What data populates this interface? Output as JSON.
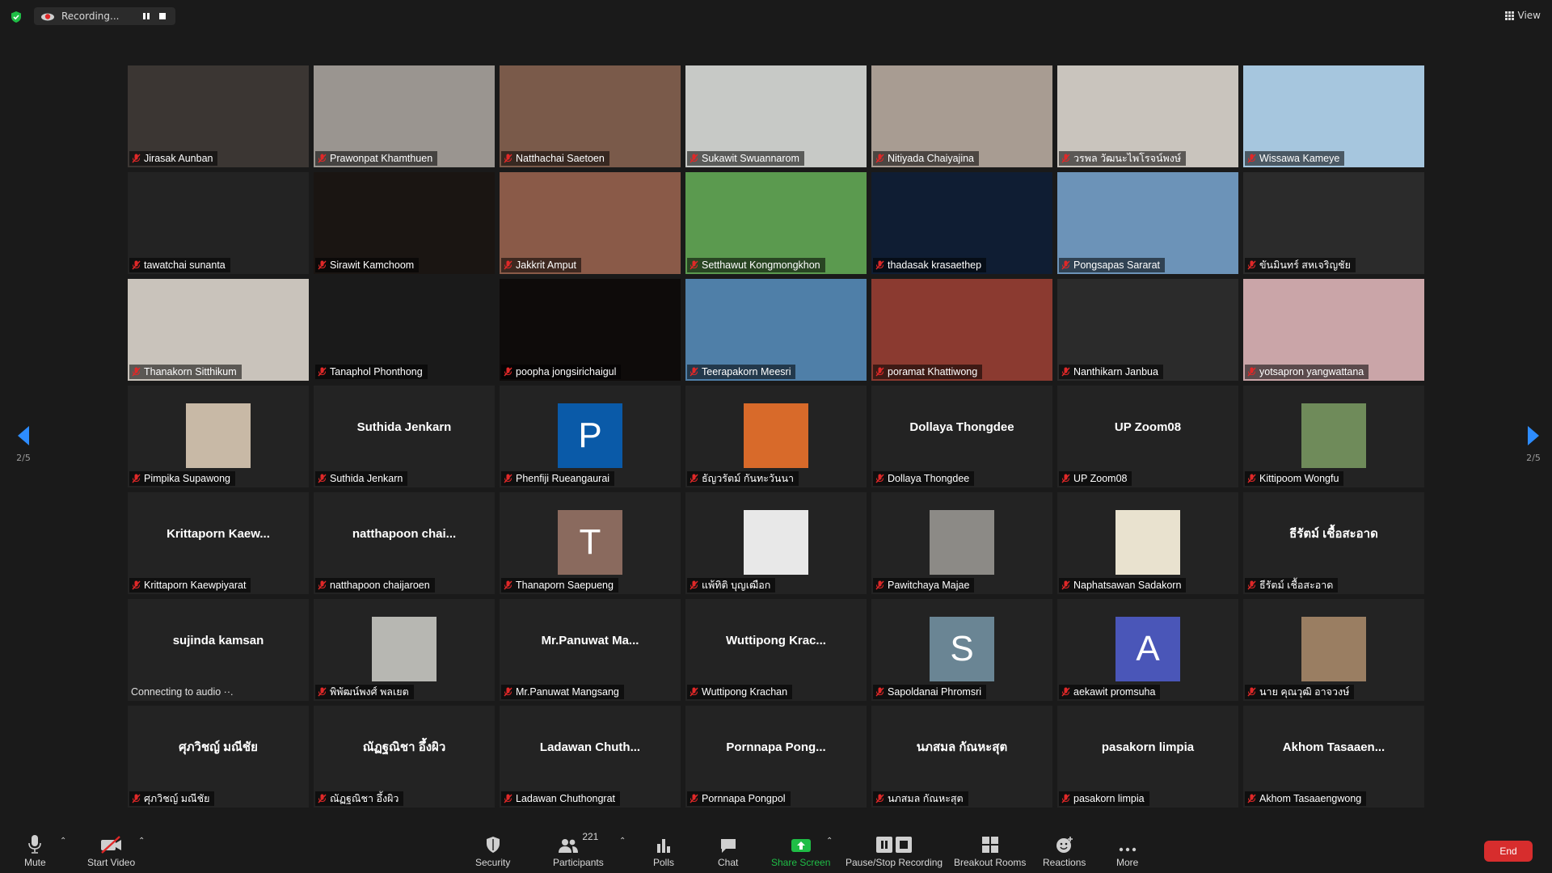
{
  "recording": {
    "label": "Recording..."
  },
  "view": {
    "label": "View"
  },
  "pager": {
    "left_label": "2/5",
    "right_label": "2/5"
  },
  "colors": {
    "accent_blue": "#2d8cff",
    "share_green": "#1fbd46",
    "end_red": "#d72d2d",
    "mic_red": "#e02828"
  },
  "participants": [
    {
      "name": "Jirasak Aunban",
      "kind": "video",
      "bg": "#3b3633"
    },
    {
      "name": "Prawonpat Khamthuen",
      "kind": "video",
      "bg": "#9a9590"
    },
    {
      "name": "Natthachai Saetoen",
      "kind": "video",
      "bg": "#7a5a4a"
    },
    {
      "name": "Sukawit Swuannarom",
      "kind": "video",
      "bg": "#c7c9c6"
    },
    {
      "name": "Nitiyada Chaiyajina",
      "kind": "video",
      "bg": "#a89c92"
    },
    {
      "name": "วรพล วัฒนะไพโรจน์พงษ์",
      "kind": "video",
      "bg": "#c9c4bd"
    },
    {
      "name": "Wissawa Kameye",
      "kind": "video",
      "bg": "#a6c6de"
    },
    {
      "name": "tawatchai sunanta",
      "kind": "blank",
      "bg": "#232323"
    },
    {
      "name": "Sirawit Kamchoom",
      "kind": "video",
      "bg": "#1a1512"
    },
    {
      "name": "Jakkrit Amput",
      "kind": "video",
      "bg": "#8a5a48"
    },
    {
      "name": "Setthawut Kongmongkhon",
      "kind": "video",
      "bg": "#5b9a4f"
    },
    {
      "name": "thadasak krasaethep",
      "kind": "video",
      "bg": "#0f1d33"
    },
    {
      "name": "Pongsapas Sararat",
      "kind": "video",
      "bg": "#6c93b8"
    },
    {
      "name": "ขันมินทร์ สหเจริญชัย",
      "kind": "video",
      "bg": "#2b2b2b"
    },
    {
      "name": "Thanakorn Sitthikum",
      "kind": "video",
      "bg": "#c9c3bb"
    },
    {
      "name": "Tanaphol Phonthong",
      "kind": "video",
      "bg": "#1a1a1a"
    },
    {
      "name": "poopha jongsirichaigul",
      "kind": "video",
      "bg": "#0e0b0a"
    },
    {
      "name": "Teerapakorn Meesri",
      "kind": "video",
      "bg": "#4f7fa8"
    },
    {
      "name": "poramat Khattiwong",
      "kind": "video",
      "bg": "#8b3a30"
    },
    {
      "name": "Nanthikarn Janbua",
      "kind": "video",
      "bg": "#2b2b2b"
    },
    {
      "name": "yotsapron yangwattana",
      "kind": "video",
      "bg": "#caa5a8"
    },
    {
      "name": "Pimpika Supawong",
      "kind": "thumb",
      "thumb": "#c8b9a6"
    },
    {
      "name": "Suthida Jenkarn",
      "kind": "text",
      "center": "Suthida Jenkarn"
    },
    {
      "name": "Phenfiji Rueangaurai",
      "kind": "avatar",
      "letter": "P",
      "avatar_color": "#0a5aa8"
    },
    {
      "name": "ธัญวรัตม์ กันทะวันนา",
      "kind": "thumb",
      "thumb": "#d86a2a"
    },
    {
      "name": "Dollaya Thongdee",
      "kind": "text",
      "center": "Dollaya Thongdee"
    },
    {
      "name": "UP Zoom08",
      "kind": "text",
      "center": "UP Zoom08"
    },
    {
      "name": "Kittipoom Wongfu",
      "kind": "thumb",
      "thumb": "#6f8b5a"
    },
    {
      "name": "Krittaporn Kaewpiyarat",
      "kind": "text",
      "center": "Krittaporn  Kaew..."
    },
    {
      "name": "natthapoon chaijaroen",
      "kind": "text",
      "center": "natthapoon  chai..."
    },
    {
      "name": "Thanaporn Saepueng",
      "kind": "avatar",
      "letter": "T",
      "avatar_color": "#8a6a5e"
    },
    {
      "name": "แพ้ทิติ บุญเฒือก",
      "kind": "thumb",
      "thumb": "#e8e8e8"
    },
    {
      "name": "Pawitchaya Majae",
      "kind": "thumb",
      "thumb": "#8c8a86"
    },
    {
      "name": "Naphatsawan Sadakorn",
      "kind": "thumb",
      "thumb": "#e9e2cf"
    },
    {
      "name": "ธีรัตม์ เชื้อสะอาด",
      "kind": "text",
      "center": "ธีรัตม์ เชื้อสะอาด"
    },
    {
      "name": "",
      "kind": "text",
      "center": "sujinda kamsan",
      "connecting": "Connecting to audio ··."
    },
    {
      "name": "พิพัฒน์พงศ์ พลเยต",
      "kind": "thumb",
      "thumb": "#b7b7b2"
    },
    {
      "name": "Mr.Panuwat Mangsang",
      "kind": "text",
      "center": "Mr.Panuwat  Ma..."
    },
    {
      "name": "Wuttipong Krachan",
      "kind": "text",
      "center": "Wuttipong  Krac..."
    },
    {
      "name": "Sapoldanai Phromsri",
      "kind": "avatar",
      "letter": "S",
      "avatar_color": "#6a8594"
    },
    {
      "name": "aekawit promsuha",
      "kind": "avatar",
      "letter": "A",
      "avatar_color": "#4a56b8"
    },
    {
      "name": "นาย คุณวุฒิ อาจวงษ์",
      "kind": "thumb",
      "thumb": "#9a7e62"
    },
    {
      "name": "ศุภวิชญ์ มณีชัย",
      "kind": "text",
      "center": "ศุภวิชญ์ มณีชัย"
    },
    {
      "name": "ณัฏฐณิชา อึ้งผิว",
      "kind": "text",
      "center": "ณัฏฐณิชา อึ้งผิว"
    },
    {
      "name": "Ladawan Chuthongrat",
      "kind": "text",
      "center": "Ladawan  Chuth..."
    },
    {
      "name": "Pornnapa Pongpol",
      "kind": "text",
      "center": "Pornnapa  Pong..."
    },
    {
      "name": "นภสมล กัณหะสุต",
      "kind": "text",
      "center": "นภสมล กัณหะสุต"
    },
    {
      "name": "pasakorn limpia",
      "kind": "text",
      "center": "pasakorn limpia"
    },
    {
      "name": "Akhom Tasaaengwong",
      "kind": "text",
      "center": "Akhom  Tasaaen..."
    }
  ],
  "toolbar": {
    "mute": "Mute",
    "start_video": "Start Video",
    "security": "Security",
    "participants": "Participants",
    "participants_count": "221",
    "polls": "Polls",
    "chat": "Chat",
    "share_screen": "Share Screen",
    "pause_stop_recording": "Pause/Stop Recording",
    "breakout_rooms": "Breakout Rooms",
    "reactions": "Reactions",
    "more": "More",
    "end": "End"
  }
}
